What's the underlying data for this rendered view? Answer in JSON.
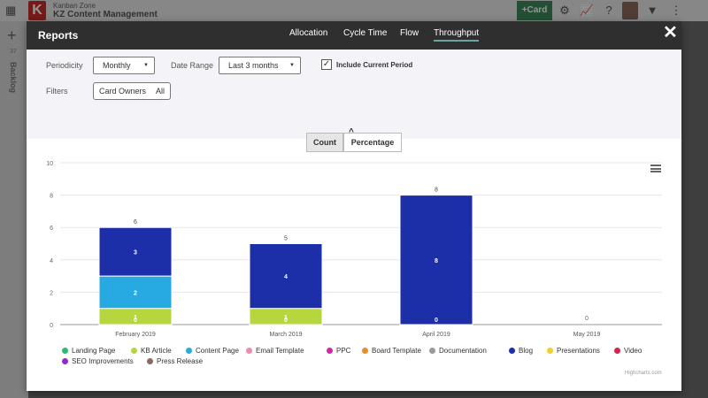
{
  "app": {
    "subtitle": "Kanban Zone",
    "title": "KZ Content Management",
    "card_button": "+Card",
    "backlog": "Backlog",
    "backlog_count": "37"
  },
  "modal": {
    "title": "Reports",
    "tabs": [
      "Allocation",
      "Cycle Time",
      "Flow",
      "Throughput"
    ],
    "active_tab": "Throughput",
    "close_icon": "close-icon"
  },
  "filters": {
    "periodicity_label": "Periodicity",
    "periodicity_value": "Monthly",
    "date_range_label": "Date Range",
    "date_range_value": "Last 3 months",
    "include_current_label": "Include Current Period",
    "include_current_checked": true,
    "filters_label": "Filters",
    "card_owners_label": "Card Owners",
    "card_owners_value": "All"
  },
  "toggle": {
    "count": "Count",
    "percentage": "Percentage",
    "active": "Count"
  },
  "chart_data": {
    "type": "bar",
    "stacked": true,
    "categories": [
      "February 2019",
      "March 2019",
      "April 2019",
      "May 2019"
    ],
    "ylim": [
      0,
      10
    ],
    "yticks": [
      0,
      2,
      4,
      6,
      8,
      10
    ],
    "grid": true,
    "legend_position": "bottom",
    "series": [
      {
        "name": "Landing Page",
        "color": "#2eb872",
        "values": [
          0,
          0,
          0,
          0
        ]
      },
      {
        "name": "KB Article",
        "color": "#b5d63d",
        "values": [
          1,
          1,
          0,
          0
        ]
      },
      {
        "name": "Content Page",
        "color": "#27aae1",
        "values": [
          2,
          0,
          0,
          0
        ]
      },
      {
        "name": "Email Template",
        "color": "#f08ab0",
        "values": [
          0,
          0,
          0,
          0
        ]
      },
      {
        "name": "PPC",
        "color": "#c82aa8",
        "values": [
          0,
          0,
          0,
          0
        ]
      },
      {
        "name": "Board Template",
        "color": "#e98a2e",
        "values": [
          0,
          0,
          0,
          0
        ]
      },
      {
        "name": "Documentation",
        "color": "#9a9a9a",
        "values": [
          0,
          0,
          0,
          0
        ]
      },
      {
        "name": "Blog",
        "color": "#1d2fa8",
        "values": [
          3,
          4,
          8,
          0
        ]
      },
      {
        "name": "Presentations",
        "color": "#f2d12a",
        "values": [
          0,
          0,
          0,
          0
        ]
      },
      {
        "name": "Video",
        "color": "#d6254d",
        "values": [
          0,
          0,
          0,
          0
        ]
      },
      {
        "name": "SEO Improvements",
        "color": "#8e2bd0",
        "values": [
          0,
          0,
          0,
          0
        ]
      },
      {
        "name": "Press Release",
        "color": "#8c6a60",
        "values": [
          0,
          0,
          0,
          0
        ]
      }
    ],
    "totals": [
      6,
      5,
      8,
      0
    ]
  },
  "credits": "Highcharts.com"
}
